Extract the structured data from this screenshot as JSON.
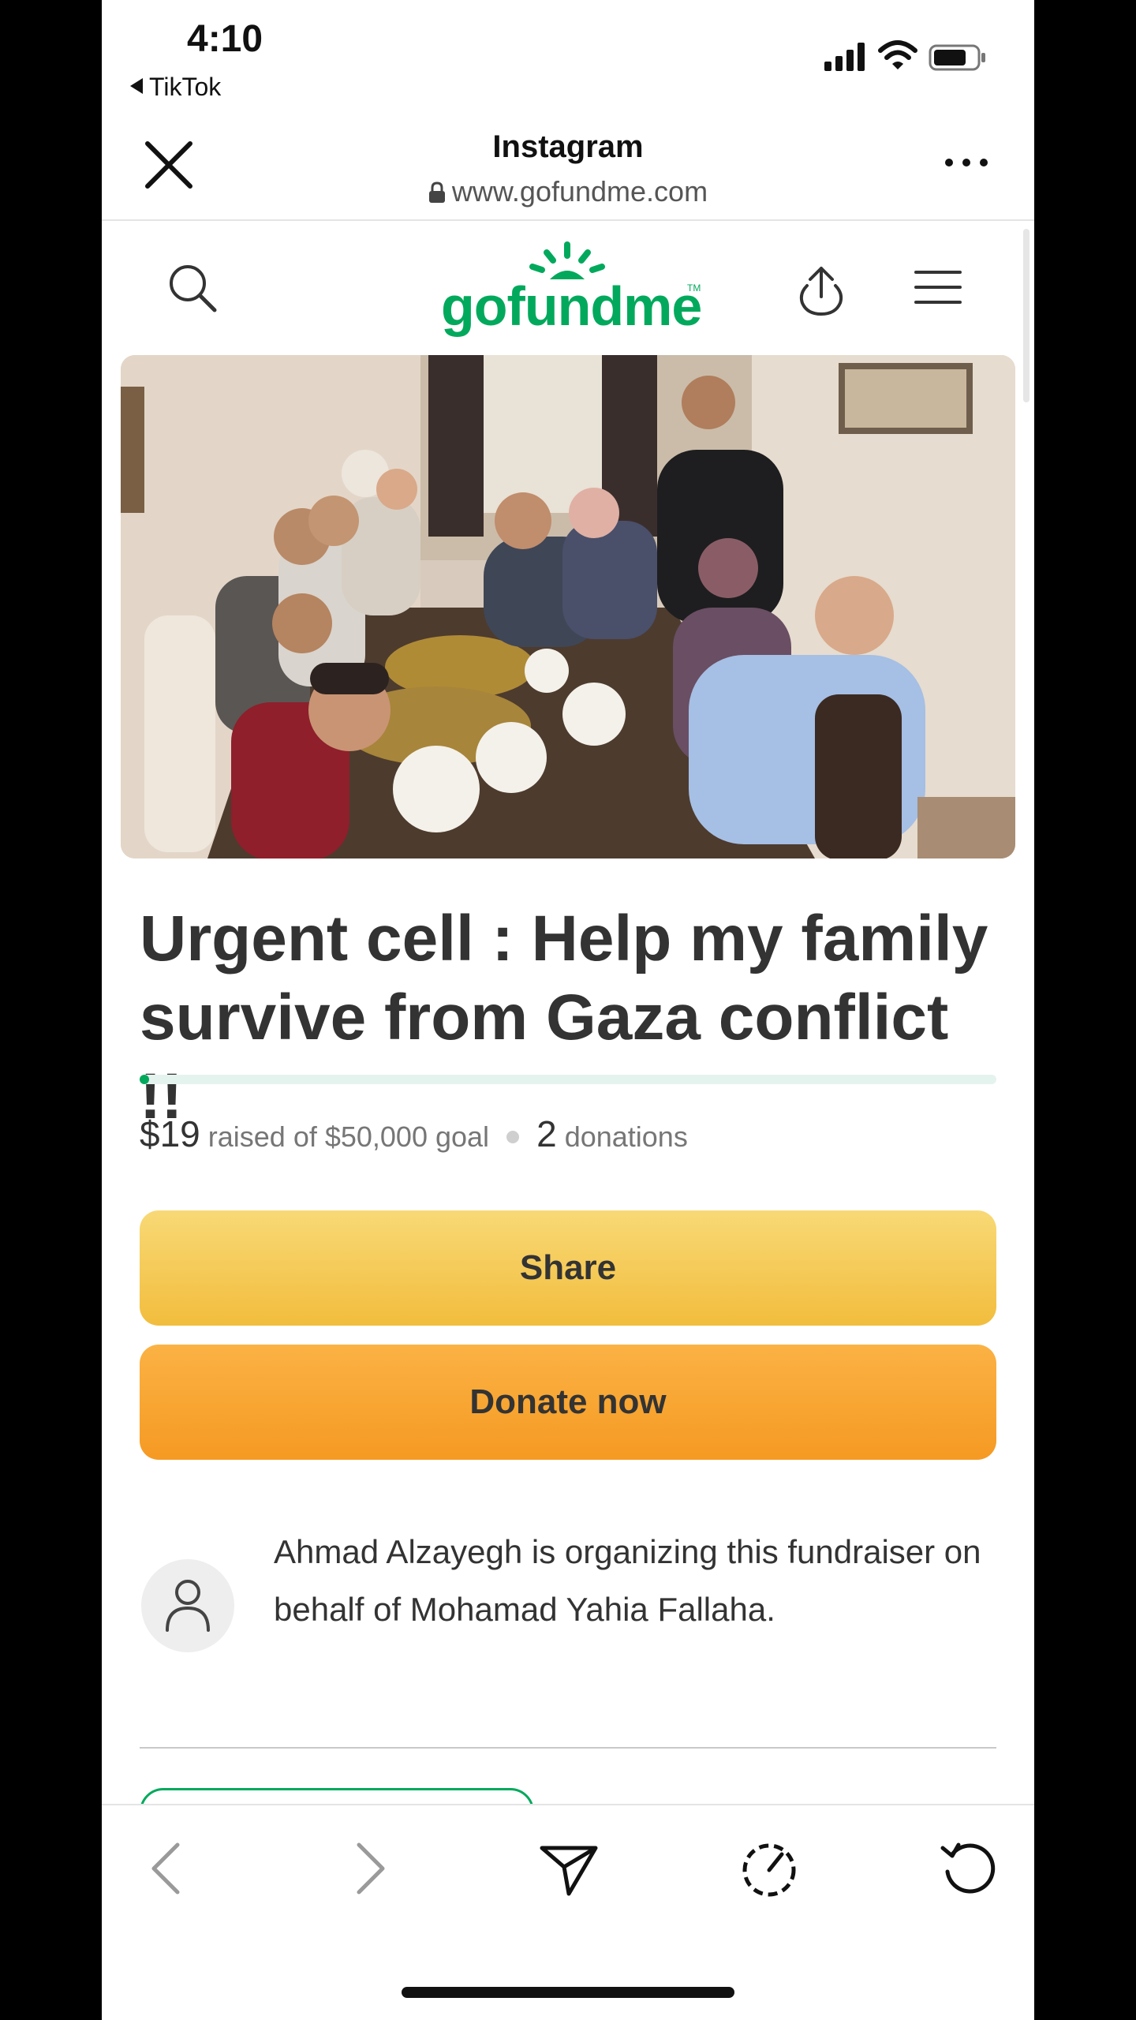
{
  "status_bar": {
    "time": "4:10",
    "back_app": "TikTok"
  },
  "browser": {
    "title": "Instagram",
    "url": "www.gofundme.com"
  },
  "site": {
    "logo_text": "gofundme",
    "logo_mark": "TM"
  },
  "campaign": {
    "title": "Urgent cell : Help my family survive from Gaza conflict !!",
    "raised": "$19",
    "raised_text": "raised of $50,000 goal",
    "donation_count": "2",
    "donations_label": "donations",
    "progress_fraction": 0.00038,
    "share_label": "Share",
    "donate_label": "Donate now",
    "organizer_text": "Ahmad Alzayegh is organizing this fundraiser on behalf of Mohamad Yahia Fallaha."
  },
  "colors": {
    "brand_green": "#02a95c",
    "share_yellow": "#f5c851",
    "donate_orange": "#f7a530"
  },
  "icons": [
    "close-icon",
    "lock-icon",
    "more-icon",
    "search-icon",
    "upload-icon",
    "menu-icon",
    "back-icon",
    "forward-icon",
    "send-icon",
    "speed-icon",
    "reload-icon",
    "user-icon"
  ]
}
